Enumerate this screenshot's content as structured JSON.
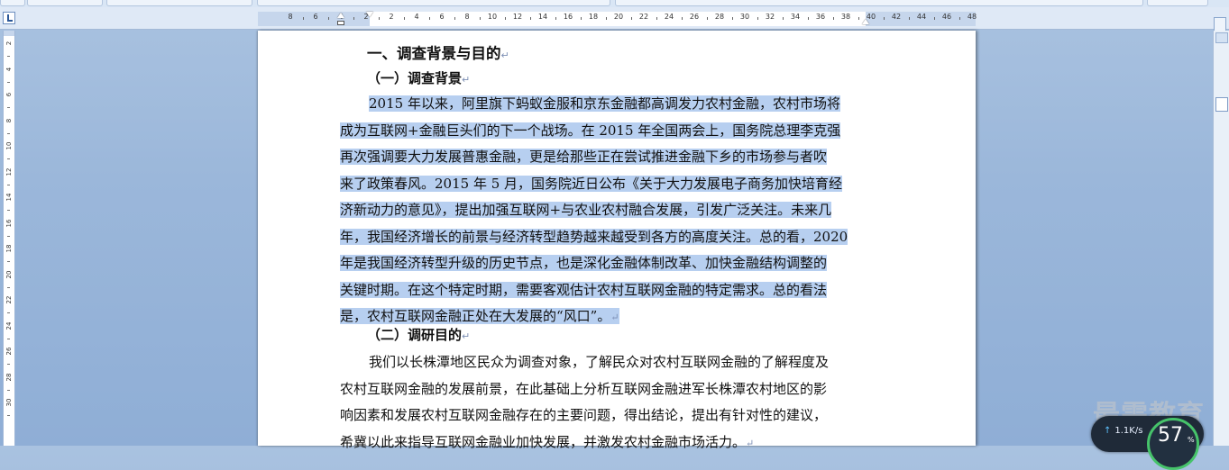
{
  "ruler": {
    "horizontal_labels": [
      "8",
      "6",
      "4",
      "2",
      "2",
      "4",
      "6",
      "8",
      "10",
      "12",
      "14",
      "16",
      "18",
      "20",
      "22",
      "24",
      "26",
      "28",
      "30",
      "32",
      "34",
      "36",
      "38",
      "40",
      "42",
      "44",
      "46",
      "48"
    ],
    "vertical_labels": [
      "2",
      "4",
      "6",
      "8",
      "10",
      "12",
      "14",
      "16",
      "18",
      "20",
      "22",
      "24",
      "26",
      "28",
      "30"
    ]
  },
  "document": {
    "heading1": "一、调查背景与目的",
    "section1_heading": "（一）调查背景",
    "section1_lines": [
      "2015 年以来，阿里旗下蚂蚁金服和京东金融都高调发力农村金融，农村市场将",
      "成为互联网+金融巨头们的下一个战场。在 2015 年全国两会上，国务院总理李克强",
      "再次强调要大力发展普惠金融，更是给那些正在尝试推进金融下乡的市场参与者吹",
      "来了政策春风。2015 年 5 月，国务院近日公布《关于大力发展电子商务加快培育经",
      "济新动力的意见》，提出加强互联网+与农业农村融合发展，引发广泛关注。未来几",
      "年，我国经济增长的前景与经济转型趋势越来越受到各方的高度关注。总的看，2020",
      "年是我国经济转型升级的历史节点，也是深化金融体制改革、加快金融结构调整的",
      "关键时期。在这个特定时期，需要客观估计农村互联网金融的特定需求。总的看法",
      "是，农村互联网金融正处在大发展的“风口”。"
    ],
    "section2_heading": "（二）调研目的",
    "section2_lines": [
      "我们以长株潭地区民众为调查对象，了解民众对农村互联网金融的了解程度及",
      "农村互联网金融的发展前景，在此基础上分析互联网金融进军长株潭农村地区的影",
      "响因素和发展农村互联网金融存在的主要问题，得出结论，提出有针对性的建议，",
      "希冀以此来指导互联网金融业加快发展，并激发农村金融市场活力。"
    ],
    "paragraph_mark": "↵"
  },
  "watermark": "最需教育",
  "net_widget": {
    "speed": "1.1K/s",
    "percent": "57",
    "percent_sign": "%"
  },
  "colors": {
    "selection": "#b7cff0",
    "background": "#9bb7da",
    "accent": "#2b5797"
  }
}
